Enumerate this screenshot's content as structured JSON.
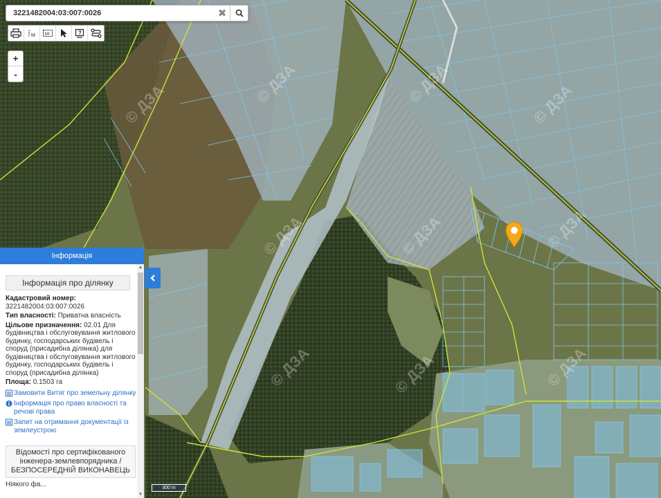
{
  "search": {
    "value": "3221482004:03:007:0026"
  },
  "toolbar": {
    "tools": [
      {
        "name": "print-icon"
      },
      {
        "name": "measure-distance-icon"
      },
      {
        "name": "measure-area-icon"
      },
      {
        "name": "pointer-icon"
      },
      {
        "name": "info-icon"
      },
      {
        "name": "layers-icon"
      }
    ]
  },
  "zoom": {
    "in_label": "+",
    "out_label": "-"
  },
  "scale": {
    "label": "300 m"
  },
  "panel": {
    "header": "Інформація",
    "section_title": "Інформація про ділянку",
    "cadastral_label": "Кадастровий номер:",
    "cadastral_value": "3221482004:03:007:0026",
    "ownership_label": "Тип власності:",
    "ownership_value": "Приватна власність",
    "purpose_label": "Цільове призначення:",
    "purpose_value": "02.01 Для будівництва і обслуговування житлового будинку, господарських будівель і споруд (присадибна ділянка) для будівництва і обслуговування житлового будинку, господарських будівель і споруд (присадибна ділянка)",
    "area_label": "Площа:",
    "area_value": "0.1503 га",
    "links": [
      {
        "icon": "document-icon",
        "label": "Замовити Витяг про земельну ділянку"
      },
      {
        "icon": "info-circle-icon",
        "label": "Інформація про право власності та речові права"
      },
      {
        "icon": "document-icon",
        "label": "Запит на отримання документації із землеустрою"
      }
    ],
    "cert_box": "Відомості про сертифікованого інженера-землевпорядника / БЕЗПОСЕРЕДНІЙ ВИКОНАВЕЦЬ",
    "cert_after": "Ніякого фа..."
  },
  "colors": {
    "accent": "#2d7ddb",
    "parcel_line": "#7fc8f0",
    "boundary_line": "#c8e63a",
    "marker": "#f5a818"
  },
  "watermark": "© ДЗА"
}
